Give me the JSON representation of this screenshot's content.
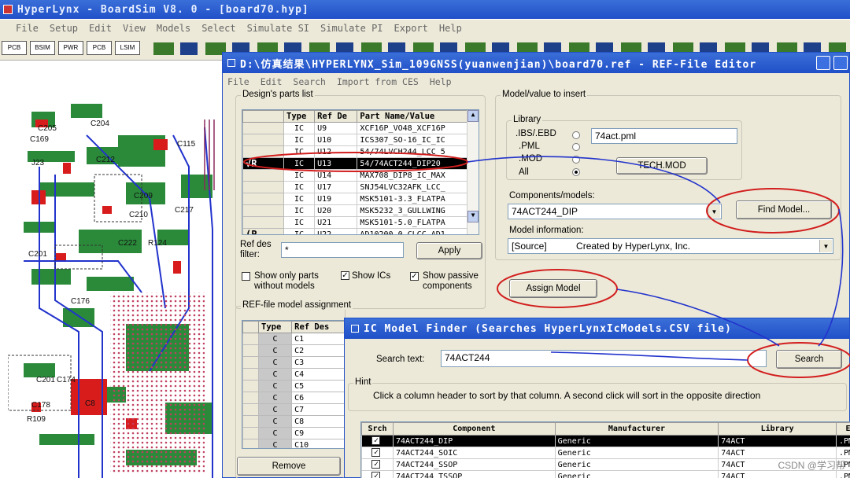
{
  "main_window": {
    "title": "HyperLynx - BoardSim V8. 0 - [board70.hyp]",
    "menu": [
      "File",
      "Setup",
      "Edit",
      "View",
      "Models",
      "Select",
      "Simulate SI",
      "Simulate PI",
      "Export",
      "Help"
    ],
    "toolbar": [
      "PCB",
      "BSIM",
      "PWR",
      "PCB",
      "LSIM"
    ]
  },
  "pcb_labels": [
    "C204",
    "C205",
    "C169",
    "J23",
    "C212",
    "C115",
    "C209",
    "C217",
    "C210",
    "C222",
    "R124",
    "C201",
    "C176",
    "C201",
    "C174",
    "C178",
    "R109",
    "C8"
  ],
  "ref_editor": {
    "title": "D:\\仿真结果\\HYPERLYNX_Sim_109GNSS(yuanwenjian)\\board70.ref - REF-File Editor",
    "menu": [
      "File",
      "Edit",
      "Search",
      "Import from CES",
      "Help"
    ],
    "parts_group_label": "Design's parts list",
    "parts_columns": [
      "Type",
      "Ref De",
      "Part Name/Value"
    ],
    "parts_rows": [
      {
        "type": "IC",
        "ref": "U9",
        "part": "XCF16P_VO48_XCF16P",
        "marker": ""
      },
      {
        "type": "IC",
        "ref": "U10",
        "part": "ICS307_SO-16_IC_IC",
        "marker": ""
      },
      {
        "type": "IC",
        "ref": "U12",
        "part": "54/74LVCH244_LCC_5",
        "marker": ""
      },
      {
        "type": "IC",
        "ref": "U13",
        "part": "54/74ACT244_DIP20_",
        "marker": "√R"
      },
      {
        "type": "IC",
        "ref": "U14",
        "part": "MAX708_DIP8_IC_MAX",
        "marker": ""
      },
      {
        "type": "IC",
        "ref": "U17",
        "part": "SNJ54LVC32AFK_LCC_",
        "marker": ""
      },
      {
        "type": "IC",
        "ref": "U19",
        "part": "MSK5101-3.3_FLATPA",
        "marker": ""
      },
      {
        "type": "IC",
        "ref": "U20",
        "part": "MSK5232_3_GULLWING",
        "marker": ""
      },
      {
        "type": "IC",
        "ref": "U21",
        "part": "MSK5101-5.0_FLATPA",
        "marker": ""
      },
      {
        "type": "IC",
        "ref": "U22",
        "part": "AD10200_0_CLCC_AD1",
        "marker": "(P"
      }
    ],
    "ref_filter_label": "Ref des filter:",
    "ref_filter_value": "*",
    "apply": "Apply",
    "show_only_without": "Show only parts without models",
    "show_ics": "Show ICs",
    "show_passive": "Show passive components",
    "model_group_label": "Model/value to insert",
    "library_label": "Library",
    "lib_types": [
      ".IBS/.EBD",
      ".PML",
      ".MOD",
      "All"
    ],
    "library_value": "74act.pml",
    "tech_mod": "TECH.MOD",
    "components_label": "Components/models:",
    "components_value": "74ACT244_DIP",
    "find_model": "Find Model...",
    "model_info_label": "Model information:",
    "model_info_source": "[Source]",
    "model_info_value": "Created by HyperLynx, Inc.",
    "assign_model": "Assign Model",
    "ref_assign_label": "REF-file model assignment",
    "assign_columns": [
      "Type",
      "Ref Des"
    ],
    "assign_rows": [
      {
        "type": "C",
        "ref": "C1"
      },
      {
        "type": "C",
        "ref": "C2"
      },
      {
        "type": "C",
        "ref": "C3"
      },
      {
        "type": "C",
        "ref": "C4"
      },
      {
        "type": "C",
        "ref": "C5"
      },
      {
        "type": "C",
        "ref": "C6"
      },
      {
        "type": "C",
        "ref": "C7"
      },
      {
        "type": "C",
        "ref": "C8"
      },
      {
        "type": "C",
        "ref": "C9"
      },
      {
        "type": "C",
        "ref": "C10"
      }
    ],
    "remove": "Remove"
  },
  "finder": {
    "title": "IC Model Finder  (Searches HyperLynxIcModels.CSV file)",
    "search_label": "Search text:",
    "search_value": "74ACT244",
    "search_button": "Search",
    "hint_label": "Hint",
    "hint_text": "Click a column header to sort by that column.  A second click will sort in the opposite direction",
    "columns": [
      "Srch",
      "Component",
      "Manufacturer",
      "Library",
      "Ex"
    ],
    "rows": [
      {
        "component": "74ACT244_DIP",
        "manufacturer": "Generic",
        "library": "74ACT",
        "ext": ".PM"
      },
      {
        "component": "74ACT244_SOIC",
        "manufacturer": "Generic",
        "library": "74ACT",
        "ext": ".PM"
      },
      {
        "component": "74ACT244_SSOP",
        "manufacturer": "Generic",
        "library": "74ACT",
        "ext": ".PM"
      },
      {
        "component": "74ACT244_TSSOP",
        "manufacturer": "Generic",
        "library": "74ACT",
        "ext": ".PM"
      }
    ]
  },
  "watermark": "CSDN @学习帮"
}
